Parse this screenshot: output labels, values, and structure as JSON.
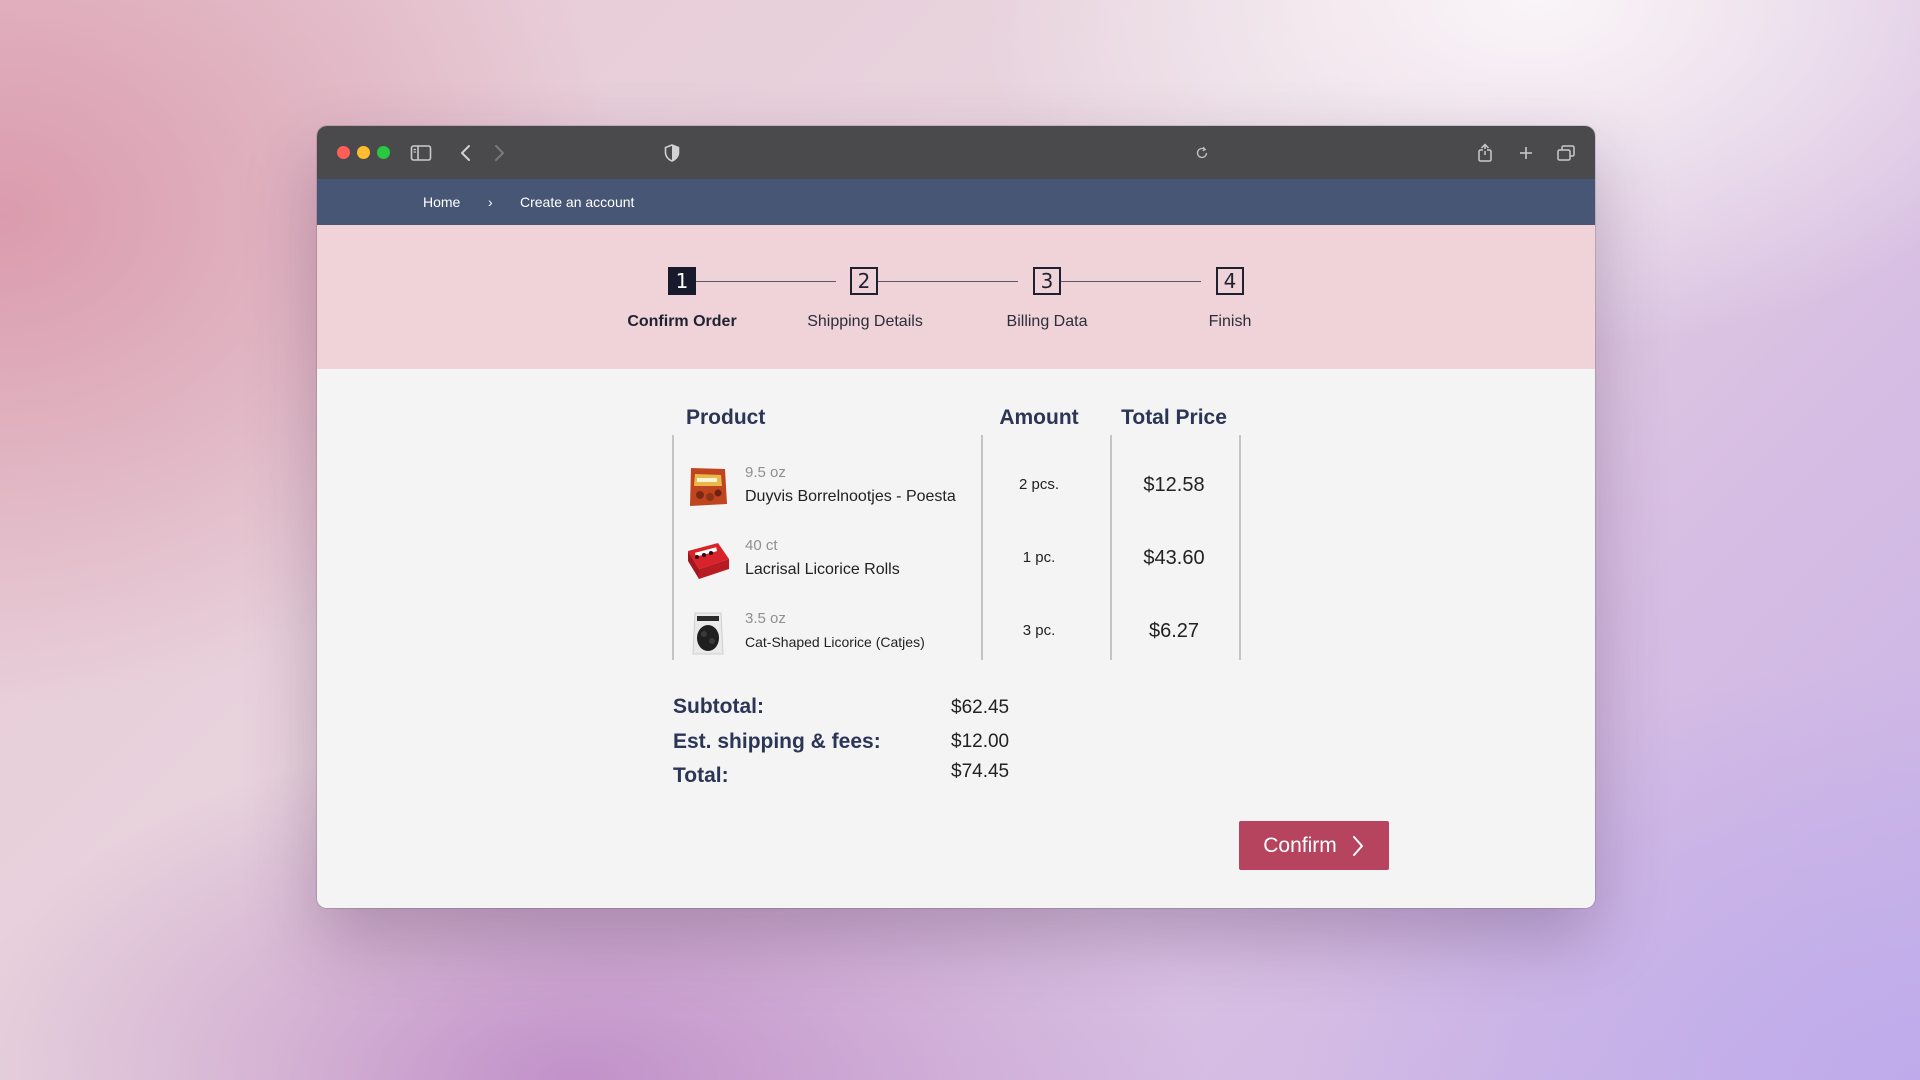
{
  "breadcrumb": {
    "home": "Home",
    "separator": "›",
    "current": "Create an account"
  },
  "steps": [
    {
      "number": "1",
      "label": "Confirm Order"
    },
    {
      "number": "2",
      "label": "Shipping Details"
    },
    {
      "number": "3",
      "label": "Billing Data"
    },
    {
      "number": "4",
      "label": "Finish"
    }
  ],
  "active_step": 1,
  "table": {
    "headers": {
      "product": "Product",
      "amount": "Amount",
      "total_price": "Total Price"
    },
    "rows": [
      {
        "size": "9.5 oz",
        "name": "Duyvis Borrelnootjes - Poesta",
        "amount": "2 pcs.",
        "price": "$12.58",
        "thumb_icon": "snack-bag-thumbnail"
      },
      {
        "size": "40 ct",
        "name": "Lacrisal Licorice Rolls",
        "amount": "1 pc.",
        "price": "$43.60",
        "thumb_icon": "licorice-box-thumbnail"
      },
      {
        "size": "3.5 oz",
        "name": "Cat-Shaped Licorice (Catjes)",
        "amount": "3 pc.",
        "price": "$6.27",
        "thumb_icon": "licorice-bag-thumbnail"
      }
    ]
  },
  "summary": {
    "subtotal_label": "Subtotal:",
    "subtotal": "$62.45",
    "shipping_label": "Est. shipping & fees:",
    "shipping": "$12.00",
    "total_label": "Total:",
    "total": "$74.45"
  },
  "confirm_label": "Confirm",
  "colors": {
    "titlebar": "#4a4a4c",
    "navbar": "#475675",
    "step_band": "#efd3d8",
    "heading": "#2b3556",
    "confirm_button": "#b7445f"
  }
}
